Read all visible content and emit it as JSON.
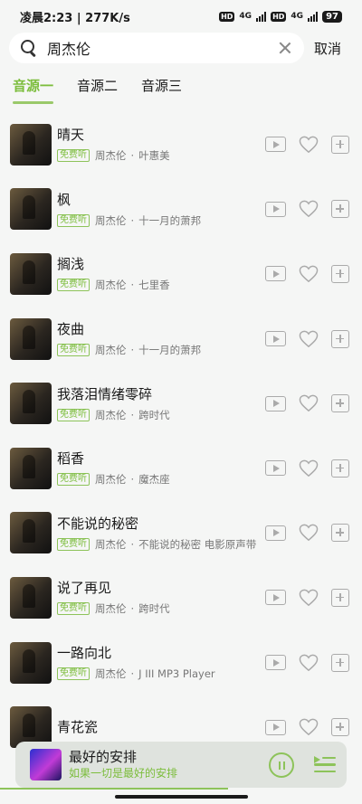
{
  "status": {
    "time": "凌晨2:23",
    "speed": "277K/s",
    "hd1": "HD",
    "net1": "4G",
    "hd2": "HD",
    "net2": "4G",
    "battery": "97"
  },
  "search": {
    "value": "周杰伦",
    "cancel_label": "取消",
    "icon": "search-icon"
  },
  "tabs": [
    {
      "label": "音源一",
      "active": true
    },
    {
      "label": "音源二",
      "active": false
    },
    {
      "label": "音源三",
      "active": false
    }
  ],
  "badge_label": "免费听",
  "songs": [
    {
      "title": "晴天",
      "artist": "周杰伦",
      "album": "叶惠美"
    },
    {
      "title": "枫",
      "artist": "周杰伦",
      "album": "十一月的萧邦"
    },
    {
      "title": "搁浅",
      "artist": "周杰伦",
      "album": "七里香"
    },
    {
      "title": "夜曲",
      "artist": "周杰伦",
      "album": "十一月的萧邦"
    },
    {
      "title": "我落泪情绪零碎",
      "artist": "周杰伦",
      "album": "跨时代"
    },
    {
      "title": "稻香",
      "artist": "周杰伦",
      "album": "魔杰座"
    },
    {
      "title": "不能说的秘密",
      "artist": "周杰伦",
      "album": "不能说的秘密 电影原声带"
    },
    {
      "title": "说了再见",
      "artist": "周杰伦",
      "album": "跨时代"
    },
    {
      "title": "一路向北",
      "artist": "周杰伦",
      "album": "J III MP3 Player"
    },
    {
      "title": "青花瓷",
      "artist": "",
      "album": ""
    }
  ],
  "separator": "·",
  "player": {
    "title": "最好的安排",
    "subtitle": "如果一切是最好的安排",
    "progress": 0.63
  },
  "colors": {
    "accent": "#7cbd3c",
    "background": "#f5f6f5",
    "icon_gray": "#aaaaaa"
  }
}
